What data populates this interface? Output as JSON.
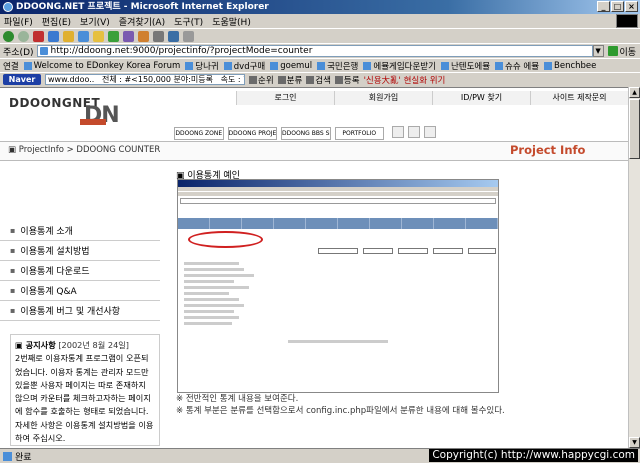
{
  "window": {
    "title": "DDOONG.NET 프로젝트 - Microsoft Internet Explorer"
  },
  "menubar": [
    "파일(F)",
    "편집(E)",
    "보기(V)",
    "즐겨찾기(A)",
    "도구(T)",
    "도움말(H)"
  ],
  "address": {
    "label": "주소(D)",
    "url": "http://ddoong.net:9000/projectinfo/?projectMode=counter",
    "go": "이동"
  },
  "links": {
    "label": "연결",
    "items": [
      "Welcome to EDonkey Korea Forum",
      "당나귀",
      "dvd구매",
      "goemul",
      "국민은행",
      "에뮬게임다운받기",
      "난텐도에뮬",
      "슈슈 에뮬",
      "Benchbee"
    ]
  },
  "navbar": {
    "logo": "Naver",
    "input": "www.ddoo..",
    "stats": "전체 : #<150,000  분야:미등록",
    "speed": "속도 : 7초",
    "btn_scrap": "순위",
    "btn_class": "분류",
    "btn_search": "검색",
    "btn_reg": "등록",
    "hot": "'신용大亂' 현실화 위기"
  },
  "page": {
    "logo_text": "DDOONGNET",
    "logo_dn": "DN",
    "toplinks": [
      "로그인",
      "회원가입",
      "ID/PW 찾기",
      "사이트 제작문의"
    ],
    "menu": [
      "DDOONG ZONE",
      "DDOONG PROJECT",
      "DDOONG BBS SKIN",
      "PORTFOLIO"
    ],
    "breadcrumb": "ProjectInfo > DDOONG COUNTER",
    "project_info": "Project Info",
    "left_menu": [
      "이용통계 소개",
      "이용통계 설치방법",
      "이용통계 다운로드",
      "이용통계 Q&A",
      "이용통계 버그 및 개선사항"
    ],
    "notice": {
      "title": "공지사항",
      "date": "[2002년 8월 24일]",
      "body": "2번째로 이용자통계 프로그램이 오픈되었습니다. 이용자 통계는 관리자 모드만 있을뿐 사용자 페이지는 따로 존재하지 않으며 카운터를 체크하고자하는 페이지에 함수를 호출하는 형태로 되었습니다. 자세한 사항은 이용통계 설치방법을 이용하여 주십시오."
    },
    "section_title": "이용통계 예인",
    "desc_1": "※ 전반적인 통계 내용을 보여준다.",
    "desc_2": "※ 통계 부분은 분류를 선택함으로서 config.inc.php파일에서 분류한 내용에 대해 볼수있다."
  },
  "status": {
    "text": "완료"
  },
  "watermark": "Copyright(c) http://www.happycgi.com"
}
